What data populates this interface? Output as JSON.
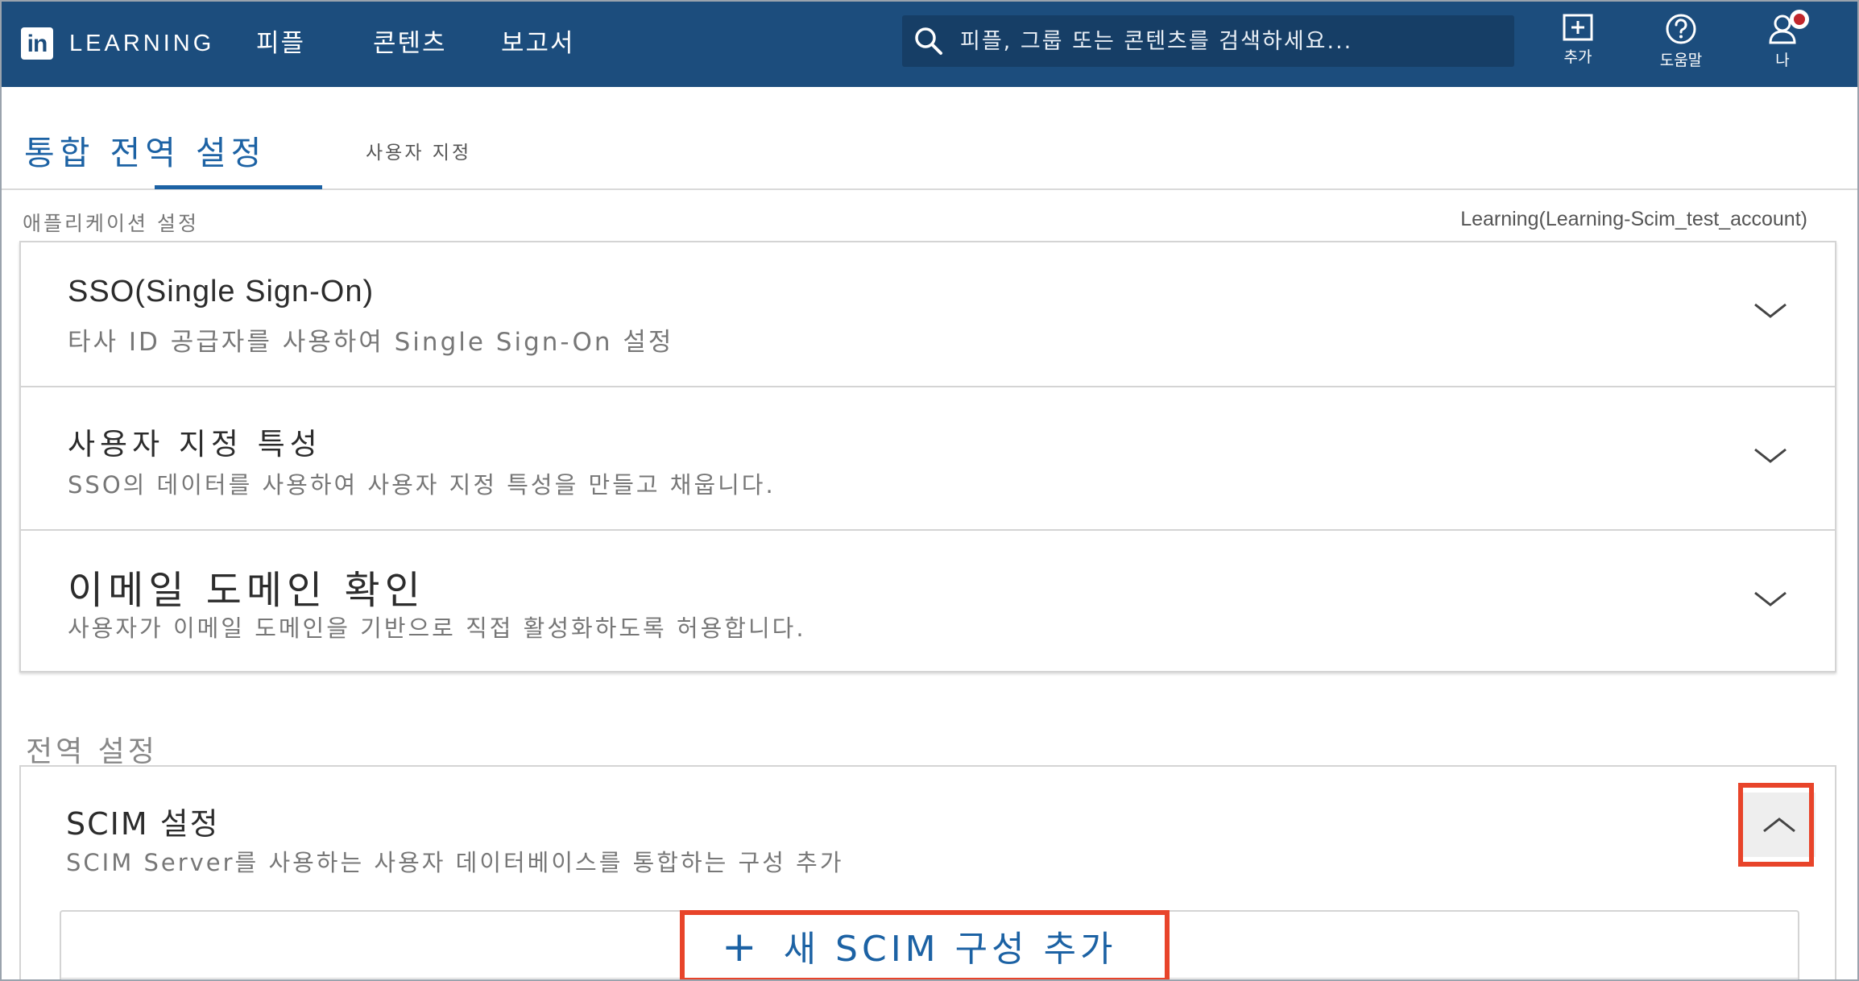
{
  "header": {
    "logo_text": "in",
    "brand": "LEARNING",
    "nav": [
      "피플",
      "콘텐츠",
      "보고서"
    ],
    "search_placeholder": "피플, 그룹 또는 콘텐츠를 검색하세요...",
    "add_label": "추가",
    "help_label": "도움말",
    "me_label": "나"
  },
  "tabs": {
    "active": "통합 전역 설정",
    "other": "사용자 지정"
  },
  "app_settings": {
    "label": "애플리케이션 설정",
    "account": "Learning(Learning-Scim_test_account)",
    "items": [
      {
        "title": "SSO(Single Sign-On)",
        "description": "타사 ID 공급자를 사용하여 Single  Sign-On 설정"
      },
      {
        "title": "사용자 지정 특성",
        "description": "SSO의 데이터를 사용하여 사용자 지정 특성을 만들고 채웁니다."
      },
      {
        "title": "이메일 도메인 확인",
        "description": "사용자가 이메일 도메인을 기반으로 직접 활성화하도록 허용합니다."
      }
    ]
  },
  "global_settings": {
    "label": "전역 설정",
    "scim": {
      "title": "SCIM 설정",
      "description": "SCIM  Server를 사용하는 사용자 데이터베이스를 통합하는 구성 추가",
      "add_button": "새 SCIM 구성 추가",
      "add_icon": "+"
    }
  },
  "colors": {
    "nav_bg": "#1c4d7d",
    "accent": "#1c62a4",
    "highlight": "#e8442a",
    "notification": "#c0262c"
  }
}
